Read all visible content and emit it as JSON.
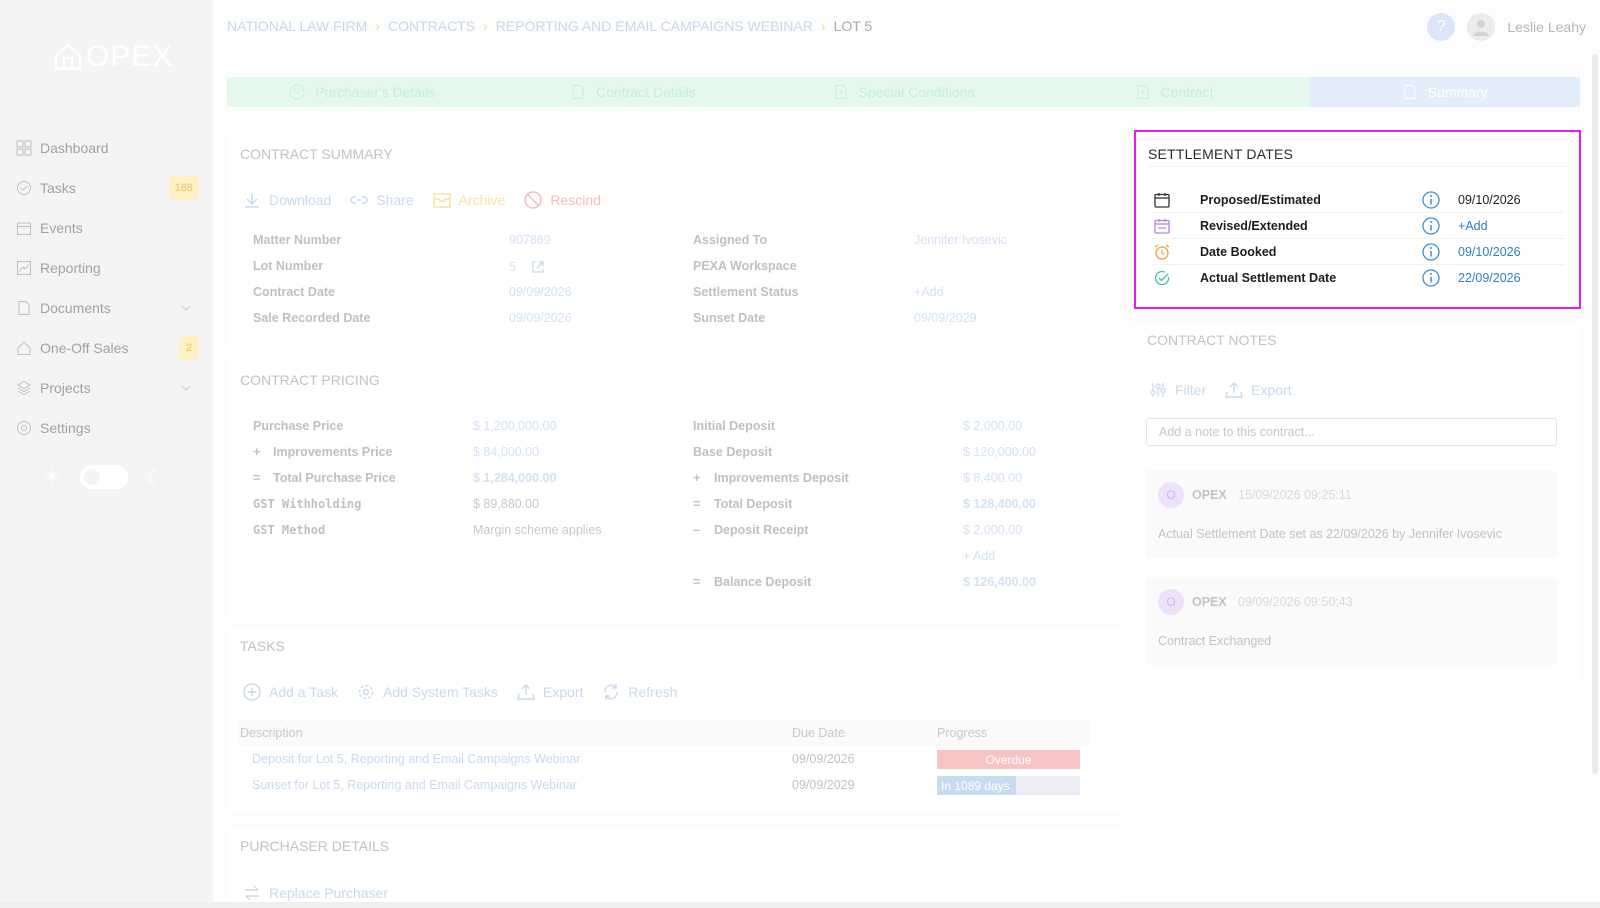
{
  "app": {
    "logo_text": "OPEX"
  },
  "breadcrumb": [
    "NATIONAL LAW FIRM",
    "CONTRACTS",
    "REPORTING AND EMAIL CAMPAIGNS WEBINAR",
    "LOT 5"
  ],
  "header": {
    "user_name": "Leslie Leahy",
    "help": "?"
  },
  "sidebar": {
    "items": [
      {
        "label": "Dashboard",
        "icon": "grid-icon"
      },
      {
        "label": "Tasks",
        "icon": "check-circle-icon",
        "badge": "188"
      },
      {
        "label": "Events",
        "icon": "calendar-icon"
      },
      {
        "label": "Reporting",
        "icon": "chart-icon"
      },
      {
        "label": "Documents",
        "icon": "document-icon",
        "expandable": true
      },
      {
        "label": "One-Off Sales",
        "icon": "house-icon",
        "badge": "2"
      },
      {
        "label": "Projects",
        "icon": "layers-icon",
        "expandable": true
      },
      {
        "label": "Settings",
        "icon": "gear-icon"
      }
    ]
  },
  "stepper": [
    {
      "label": "Purchaser's Details",
      "icon": "user-icon"
    },
    {
      "label": "Contract Details",
      "icon": "document-icon"
    },
    {
      "label": "Special Conditions",
      "icon": "document-plus-icon"
    },
    {
      "label": "Contract",
      "icon": "document-plus-icon"
    },
    {
      "label": "Summary",
      "icon": "document-icon",
      "active": true
    }
  ],
  "contract_summary": {
    "title": "CONTRACT SUMMARY",
    "actions": {
      "download": "Download",
      "share": "Share",
      "archive": "Archive",
      "rescind": "Rescind"
    },
    "left": [
      {
        "k": "Matter Number",
        "v": "907869"
      },
      {
        "k": "Lot Number",
        "v": "5"
      },
      {
        "k": "Contract Date",
        "v": "09/09/2026"
      },
      {
        "k": "Sale Recorded Date",
        "v": "09/09/2026"
      }
    ],
    "right": [
      {
        "k": "Assigned To",
        "v": "Jennifer Ivosevic"
      },
      {
        "k": "PEXA Workspace",
        "v": ""
      },
      {
        "k": "Settlement Status",
        "v": "+Add"
      },
      {
        "k": "Sunset Date",
        "v": "09/09/2029"
      }
    ]
  },
  "contract_pricing": {
    "title": "CONTRACT PRICING",
    "left": [
      {
        "op": "",
        "k": "Purchase Price",
        "v": "$ 1,200,000.00"
      },
      {
        "op": "+",
        "k": "Improvements Price",
        "v": "$ 84,000.00"
      },
      {
        "op": "=",
        "k": "Total Purchase Price",
        "v": "$ 1,284,000.00"
      },
      {
        "op": "",
        "k": "GST Withholding",
        "v": "$ 89,880.00"
      },
      {
        "op": "",
        "k": "GST Method",
        "v": "Margin scheme applies"
      }
    ],
    "right": [
      {
        "op": "",
        "k": "Initial Deposit",
        "v": "$ 2,000.00"
      },
      {
        "op": "",
        "k": "Base Deposit",
        "v": "$ 120,000.00"
      },
      {
        "op": "+",
        "k": "Improvements Deposit",
        "v": "$ 8,400.00"
      },
      {
        "op": "=",
        "k": "Total Deposit",
        "v": "$ 128,400.00"
      },
      {
        "op": "–",
        "k": "Deposit Receipt",
        "v": "$ 2,000.00"
      },
      {
        "op": "",
        "k": "",
        "v": "+ Add"
      },
      {
        "op": "=",
        "k": "Balance Deposit",
        "v": "$ 126,400.00"
      }
    ]
  },
  "tasks": {
    "title": "TASKS",
    "actions": {
      "add": "Add a Task",
      "add_system": "Add System Tasks",
      "export": "Export",
      "refresh": "Refresh"
    },
    "columns": [
      "Description",
      "Due Date",
      "Progress"
    ],
    "rows": [
      {
        "desc": "Deposit for Lot 5, Reporting and Email Campaigns Webinar",
        "due": "09/09/2026",
        "progress": "Overdue",
        "progress_fraction": 1.0
      },
      {
        "desc": "Sunset for Lot 5, Reporting and Email Campaigns Webinar",
        "due": "09/09/2029",
        "progress": "In 1089 days",
        "progress_fraction": 0.55
      }
    ]
  },
  "purchaser_details": {
    "title": "PURCHASER DETAILS",
    "replace": "Replace Purchaser"
  },
  "settlement_dates": {
    "title": "SETTLEMENT DATES",
    "rows": [
      {
        "label": "Proposed/Estimated",
        "value": "09/10/2026",
        "icon": "calendar-icon"
      },
      {
        "label": "Revised/Extended",
        "value": "+Add",
        "icon": "calendar-edit-icon"
      },
      {
        "label": "Date Booked",
        "value": "09/10/2026",
        "icon": "alarm-clock-icon"
      },
      {
        "label": "Actual Settlement Date",
        "value": "22/09/2026",
        "icon": "check-circle-icon"
      }
    ]
  },
  "contract_notes": {
    "title": "CONTRACT NOTES",
    "actions": {
      "filter": "Filter",
      "export": "Export"
    },
    "placeholder": "Add a note to this contract...",
    "notes": [
      {
        "avatar": "O",
        "author": "OPEX",
        "time": "15/09/2026 09:25:11",
        "text": "Actual Settlement Date set as 22/09/2026 by Jennifer  Ivosevic"
      },
      {
        "avatar": "O",
        "author": "OPEX",
        "time": "09/09/2026 09:50:43",
        "text": "Contract Exchanged"
      }
    ]
  },
  "colors": {
    "highlight": "#e61fe8",
    "link": "#2b7fc3",
    "step_done": "#e6f8ee",
    "step_active": "#e2eefa"
  }
}
